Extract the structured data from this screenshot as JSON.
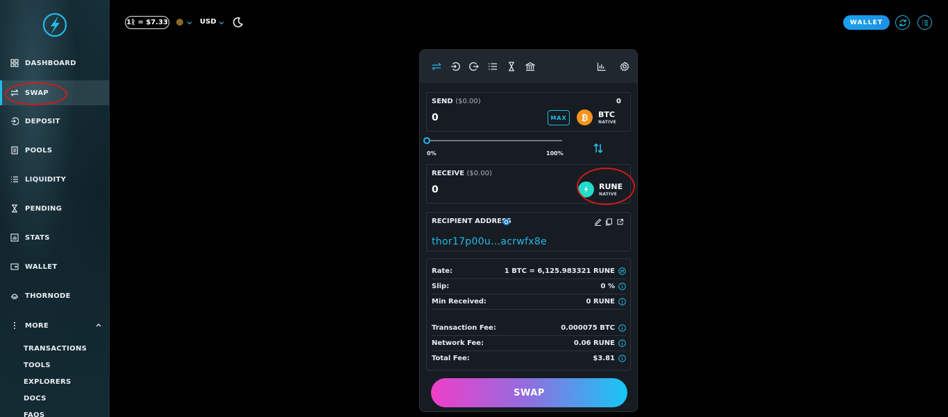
{
  "sidebar": {
    "items": [
      {
        "label": "DASHBOARD",
        "icon": "dashboard-icon"
      },
      {
        "label": "SWAP",
        "icon": "swap-icon"
      },
      {
        "label": "DEPOSIT",
        "icon": "deposit-icon"
      },
      {
        "label": "POOLS",
        "icon": "pools-icon"
      },
      {
        "label": "LIQUIDITY",
        "icon": "liquidity-icon"
      },
      {
        "label": "PENDING",
        "icon": "hourglass-icon"
      },
      {
        "label": "STATS",
        "icon": "stats-icon"
      },
      {
        "label": "WALLET",
        "icon": "wallet-icon"
      },
      {
        "label": "THORNODE",
        "icon": "thornode-icon"
      }
    ],
    "more": {
      "label": "MORE",
      "icon": "more-icon"
    },
    "more_items": [
      "TRANSACTIONS",
      "TOOLS",
      "EXPLORERS",
      "DOCS",
      "FAQS"
    ],
    "active": "SWAP"
  },
  "topbar": {
    "price": "1ᚱ = $7.33",
    "currency": "USD",
    "wallet_label": "WALLET"
  },
  "swap": {
    "send": {
      "label": "SEND",
      "usd": "($0.00)",
      "balance": "0",
      "amount": "0",
      "max_label": "MAX",
      "token": "BTC",
      "chain": "NATIVE"
    },
    "slider": {
      "min_label": "0%",
      "max_label": "100%",
      "value": 0
    },
    "receive": {
      "label": "RECEIVE",
      "usd": "($0.00)",
      "amount": "0",
      "token": "RUNE",
      "chain": "NATIVE"
    },
    "recipient": {
      "label": "RECIPIENT ADDRESS",
      "address": "thor17p00u...acrwfx8e"
    },
    "details": [
      {
        "label": "Rate:",
        "value": "1 BTC = 6,125.983321 RUNE"
      },
      {
        "label": "Slip:",
        "value": "0 %"
      },
      {
        "label": "Min Received:",
        "value": "0 RUNE"
      },
      {
        "label": "Transaction Fee:",
        "value": "0.000075 BTC"
      },
      {
        "label": "Network Fee:",
        "value": "0.06 RUNE"
      },
      {
        "label": "Total Fee:",
        "value": "$3.81"
      }
    ],
    "swap_label": "SWAP"
  },
  "colors": {
    "accent": "#25b9e8",
    "btc": "#f7931a",
    "rune": "#23dcc8",
    "annotation": "#d01a1a"
  }
}
